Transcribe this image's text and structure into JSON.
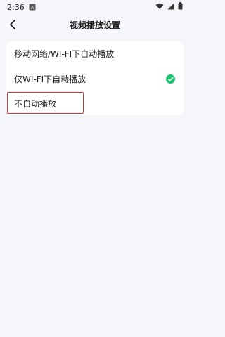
{
  "status_bar": {
    "time": "2:36",
    "notification_icon": "notification-a-icon",
    "icons": [
      "wifi-icon",
      "signal-icon",
      "battery-icon"
    ]
  },
  "header": {
    "back_icon": "back-chevron-icon",
    "title": "视频播放设置"
  },
  "options": [
    {
      "label": "移动网络/WI-FI下自动播放",
      "selected": false
    },
    {
      "label": "仅WI-FI下自动播放",
      "selected": true
    },
    {
      "label": "不自动播放",
      "selected": false
    }
  ],
  "colors": {
    "accent_check": "#19c36e",
    "highlight_border": "#e02b2b",
    "background": "#f5f6fa"
  }
}
